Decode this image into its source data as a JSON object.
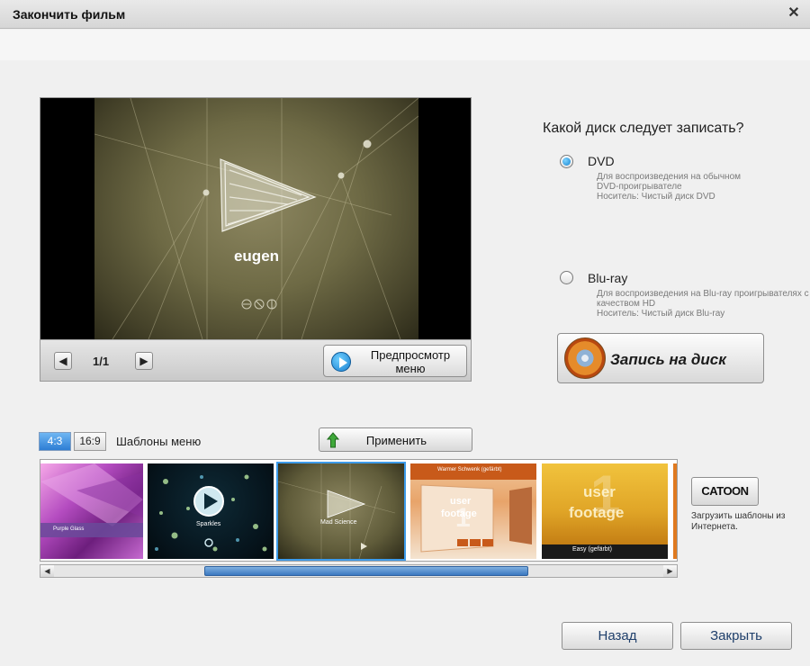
{
  "window": {
    "title": "Закончить фильм",
    "close_glyph": "✕"
  },
  "preview": {
    "menu_text": "eugen",
    "page_counter": "1/1",
    "prev_glyph": "◀",
    "next_glyph": "▶",
    "preview_button_label": "Предпросмотр меню"
  },
  "disc": {
    "question": "Какой диск следует записать?",
    "options": [
      {
        "label": "DVD",
        "selected": true,
        "desc": [
          "Для воспроизведения на обычном",
          "DVD-проигрывателе",
          "Носитель: Чистый диск DVD"
        ]
      },
      {
        "label": "Blu-ray",
        "selected": false,
        "desc": [
          "Для воспроизведения на Blu-ray проигрывателях с",
          "качеством HD",
          "Носитель: Чистый диск Blu-ray"
        ]
      }
    ],
    "burn_button_label": "Запись на диск"
  },
  "templates": {
    "aspect_options": [
      "4:3",
      "16:9"
    ],
    "aspect_selected": "4:3",
    "label": "Шаблоны меню",
    "apply_button_label": "Применить",
    "items": [
      {
        "name": "Purple Glass",
        "caption": "Purple Glass"
      },
      {
        "name": "Sparkles",
        "caption": "Sparkles"
      },
      {
        "name": "Mad Science",
        "caption": "Mad Science",
        "selected": true
      },
      {
        "name": "Warmer Schwenk (gefärbt)",
        "caption": "Warmer Schwenk (gefärbt)",
        "footage_text": [
          "user",
          "footage"
        ],
        "number": "1"
      },
      {
        "name": "Easy (gefärbt)",
        "caption": "Easy (gefärbt)",
        "footage_text": [
          "user",
          "footage"
        ],
        "number": "1"
      }
    ],
    "scroll_left_glyph": "◀",
    "scroll_right_glyph": "▶"
  },
  "catoon": {
    "button_label": "CATOON",
    "text": "Загрузить шаблоны из Интернета."
  },
  "footer": {
    "back_label": "Назад",
    "close_label": "Закрыть"
  },
  "colors": {
    "accent": "#2d7dd4",
    "selection_outline": "#3d9bea",
    "footer_text": "#1f3f6b"
  }
}
